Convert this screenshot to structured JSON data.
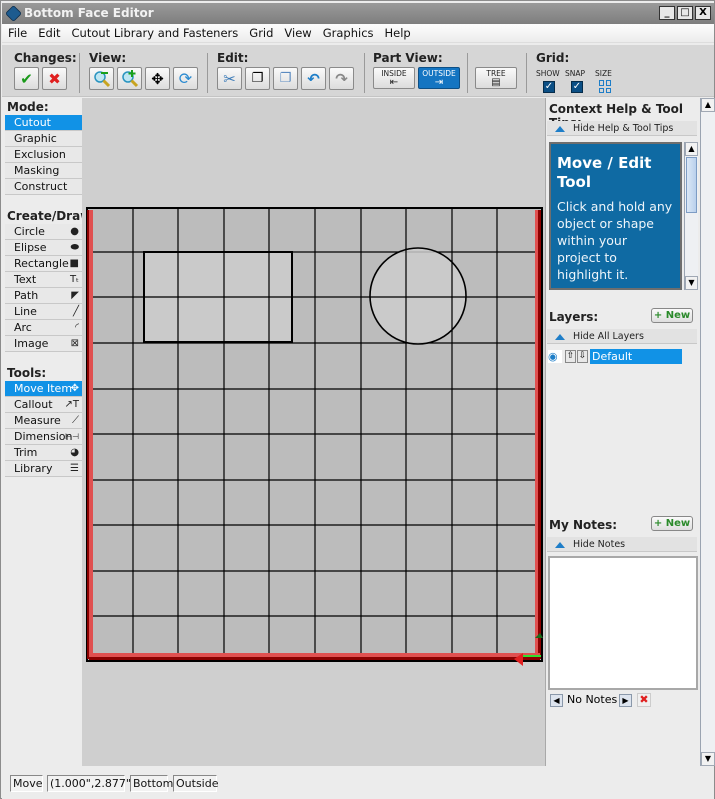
{
  "window": {
    "title": "Bottom Face Editor",
    "controls": [
      "_",
      "□",
      "X"
    ]
  },
  "menubar": {
    "items": [
      "File",
      "Edit",
      "Cutout Library and Fasteners",
      "Grid",
      "View",
      "Graphics",
      "Help"
    ]
  },
  "toolbar": {
    "changes_label": "Changes:",
    "view_label": "View:",
    "edit_label": "Edit:",
    "part_view_label": "Part View:",
    "inside_label": "INSIDE",
    "outside_label": "OUTSIDE",
    "tree_label": "TREE",
    "grid_label": "Grid:",
    "grid_show_label": "SHOW",
    "grid_snap_label": "SNAP",
    "grid_size_label": "SIZE",
    "grid_show_checked": true,
    "grid_snap_checked": true,
    "part_view_selected": "OUTSIDE"
  },
  "left": {
    "mode_label": "Mode:",
    "modes": [
      {
        "label": "Cutout",
        "selected": true
      },
      {
        "label": "Graphic",
        "selected": false
      },
      {
        "label": "Exclusion",
        "selected": false
      },
      {
        "label": "Masking",
        "selected": false
      },
      {
        "label": "Construct",
        "selected": false
      }
    ],
    "create_label": "Create/Draw:",
    "create": [
      {
        "label": "Circle",
        "icon": "circle-icon",
        "glyph": "●"
      },
      {
        "label": "Elipse",
        "icon": "ellipse-icon",
        "glyph": "⬬"
      },
      {
        "label": "Rectangle",
        "icon": "rectangle-icon",
        "glyph": "■"
      },
      {
        "label": "Text",
        "icon": "text-icon",
        "glyph": "Tₜ"
      },
      {
        "label": "Path",
        "icon": "path-icon",
        "glyph": "◤"
      },
      {
        "label": "Line",
        "icon": "line-icon",
        "glyph": "╱"
      },
      {
        "label": "Arc",
        "icon": "arc-icon",
        "glyph": "◜"
      },
      {
        "label": "Image",
        "icon": "image-icon",
        "glyph": "⊠"
      }
    ],
    "tools_label": "Tools:",
    "tools": [
      {
        "label": "Move Item",
        "icon": "move-icon",
        "glyph": "✥",
        "selected": true
      },
      {
        "label": "Callout",
        "icon": "callout-icon",
        "glyph": "↗T",
        "selected": false
      },
      {
        "label": "Measure",
        "icon": "measure-icon",
        "glyph": "⟋",
        "selected": false
      },
      {
        "label": "Dimension",
        "icon": "dimension-icon",
        "glyph": "⊢⊣",
        "selected": false
      },
      {
        "label": "Trim",
        "icon": "trim-icon",
        "glyph": "◕",
        "selected": false
      },
      {
        "label": "Library",
        "icon": "library-icon",
        "glyph": "☰",
        "selected": false
      }
    ]
  },
  "right": {
    "help_header": "Context Help & Tool Tips:",
    "hide_help_label": "Hide Help & Tool Tips",
    "help_title": "Move / Edit Tool",
    "help_text": "Click and hold any object or shape within your project to highlight it.",
    "layers_header": "Layers:",
    "new_label": "+ New",
    "hide_layers_label": "Hide All Layers",
    "layers": [
      {
        "name": "Default",
        "visible": true,
        "selected": true
      }
    ],
    "notes_header": "My Notes:",
    "hide_notes_label": "Hide Notes",
    "notes_text": "",
    "notes_nav_label": "No Notes"
  },
  "status": {
    "tool": "Move",
    "coords": "(1.000\",2.877\")",
    "face": "Bottom",
    "view": "Outside"
  },
  "colors": {
    "accent": "#1192e6",
    "help_bg": "#0f6aa3",
    "panel_outline": "#d42020",
    "canvas_fill": "#bcbcbc"
  }
}
